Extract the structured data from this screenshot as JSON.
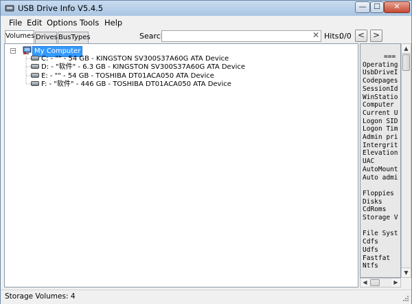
{
  "window": {
    "title": "USB Drive Info V5.4.5"
  },
  "menu": [
    "File",
    "Edit",
    "Options",
    "Tools",
    "Help"
  ],
  "tabs": [
    "Volumes",
    "Drives",
    "BusTypes"
  ],
  "search": {
    "label": "Search:",
    "value": "",
    "clear_glyph": "✕",
    "hits_label": "Hits:",
    "hits_value": "0/0",
    "prev_glyph": "<",
    "next_glyph": ">"
  },
  "tree": {
    "root": "My Computer",
    "expander_glyph": "−",
    "items": [
      {
        "label": "C: - \"\" - 54 GB - KINGSTON SV300S37A60G ATA Device"
      },
      {
        "label": "D: - \"软件\" - 6.3 GB - KINGSTON SV300S37A60G ATA Device"
      },
      {
        "label": "E: - \"\" - 54 GB - TOSHIBA DT01ACA050 ATA Device"
      },
      {
        "label": "F: - \"软件\" - 446 GB - TOSHIBA DT01ACA050 ATA Device"
      }
    ]
  },
  "info_lines": [
    "===",
    "Operating",
    "UsbDriveI",
    "Codepages",
    "SessionId",
    "WinStatio",
    "Computer",
    "Current U",
    "Logon SID",
    "Logon Tim",
    "Admin pri",
    "Intergrit",
    "Elevation",
    "UAC",
    "AutoMount",
    "Auto admi",
    "",
    "Floppies",
    "Disks",
    "CdRoms",
    "Storage V",
    "",
    "File Syst",
    "Cdfs",
    "Udfs",
    "Fastfat",
    "Ntfs"
  ],
  "status": {
    "text": "Storage Volumes: 4"
  },
  "window_controls": {
    "minimize": "—",
    "maximize": "☐",
    "close": "✕"
  },
  "scroll_glyphs": {
    "up": "▲",
    "down": "▼",
    "left": "◀",
    "right": "▶"
  },
  "icons": {
    "app": "usb-drive-icon",
    "root": "computer-icon",
    "drive": "hard-drive-icon"
  }
}
